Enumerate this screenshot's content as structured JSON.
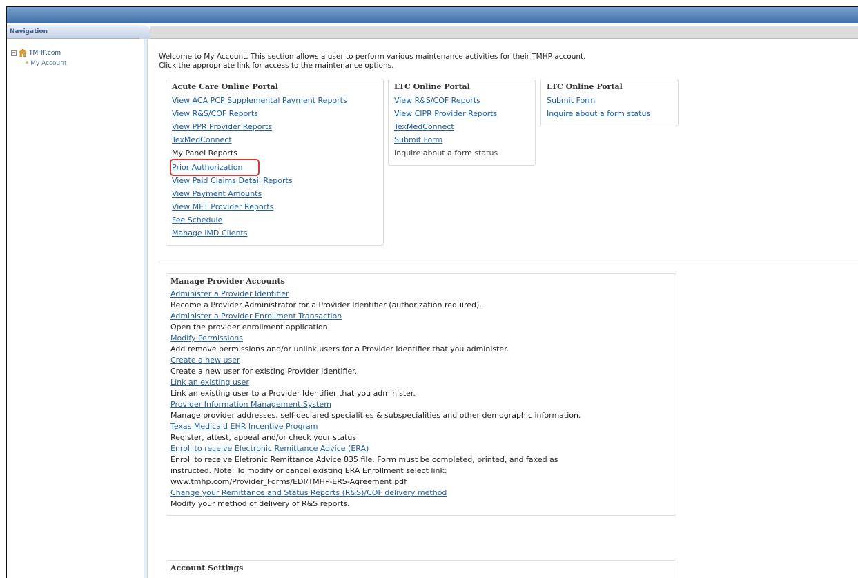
{
  "navigation": {
    "header": "Navigation",
    "root_label": "TMHP.com",
    "children": [
      "My Account"
    ]
  },
  "intro": {
    "line1": "Welcome to My Account. This section allows a user to perform various maintenance activities for their TMHP account.",
    "line2": "Click the appropriate link for access to the maintenance options."
  },
  "portals": [
    {
      "title": "Acute Care Online Portal",
      "items": [
        {
          "label": "View ACA PCP Supplemental Payment Reports",
          "link": true
        },
        {
          "label": "View R&S/COF Reports",
          "link": true
        },
        {
          "label": "View PPR Provider Reports",
          "link": true
        },
        {
          "label": "TexMedConnect",
          "link": true
        },
        {
          "label": "My Panel Reports",
          "link": false
        },
        {
          "label": "Prior Authorization",
          "link": true
        },
        {
          "label": "View Paid Claims Detail Reports",
          "link": true
        },
        {
          "label": "View Payment Amounts",
          "link": true
        },
        {
          "label": "View MET Provider Reports",
          "link": true
        },
        {
          "label": "Fee Schedule",
          "link": true
        },
        {
          "label": "Manage IMD Clients",
          "link": true
        }
      ]
    },
    {
      "title": "LTC Online Portal",
      "items": [
        {
          "label": "View R&S/COF Reports",
          "link": true
        },
        {
          "label": "View CIPR Provider Reports",
          "link": true
        },
        {
          "label": "TexMedConnect",
          "link": true
        },
        {
          "label": "Submit Form",
          "link": true
        },
        {
          "label": "Inquire about a form status",
          "link": false
        }
      ]
    },
    {
      "title": "LTC Online Portal",
      "items": [
        {
          "label": "Submit Form",
          "link": true
        },
        {
          "label": "Inquire about a form status",
          "link": true
        }
      ]
    }
  ],
  "manage": {
    "title": "Manage Provider Accounts",
    "items": [
      {
        "link": "Administer a Provider Identifier",
        "desc": "Become a Provider Administrator for a Provider Identifier (authorization required)."
      },
      {
        "link": "Administer a Provider Enrollment Transaction",
        "desc": "Open the provider enrollment application"
      },
      {
        "link": "Modify Permissions",
        "desc": "Add remove permissions and/or unlink users for a Provider Identifier that you administer."
      },
      {
        "link": "Create a new user",
        "desc": "Create a new user for existing Provider Identifier."
      },
      {
        "link": "Link an existing user",
        "desc": "Link an existing user to a Provider Identifier that you administer."
      },
      {
        "link": "Provider Information Management System",
        "desc": "Manage provider addresses, self-declared specialities & subspecialities and other demographic information."
      },
      {
        "link": "Texas Medicaid EHR Incentive Program",
        "desc": "Register, attest, appeal and/or check your status"
      },
      {
        "link": "Enroll to receive Electronic Remittance Advice (ERA)",
        "desc": "Enroll to receive Eletronic Remittance Advice 835 file. Form must be completed, printed, and faxed as instructed. Note: To modify or cancel existing ERA Enrollment select link: www.tmhp.com/Provider_Forms/EDI/TMHP-ERS-Agreement.pdf"
      },
      {
        "link": "Change your Remittance and Status Reports (R&S)/COF delivery method",
        "desc": "Modify your method of delivery of R&S reports."
      }
    ]
  },
  "account": {
    "title": "Account Settings"
  }
}
